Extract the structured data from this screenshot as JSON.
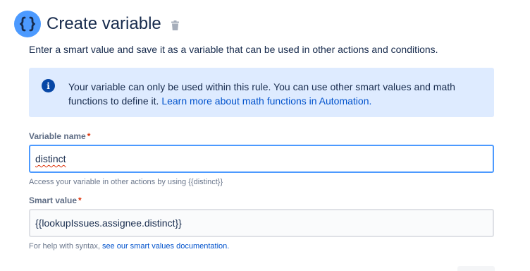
{
  "header": {
    "title": "Create variable",
    "icon": "curly-braces-icon",
    "delete_icon": "trash-icon"
  },
  "description": "Enter a smart value and save it as a variable that can be used in other actions and conditions.",
  "info": {
    "icon": "info-icon",
    "glyph": "i",
    "text": "Your variable can only be used within this rule. You can use other smart values and math functions to define it.",
    "link": "Learn more about math functions in Automation."
  },
  "fields": {
    "variable_name": {
      "label": "Variable name",
      "required": "*",
      "value": "distinct",
      "helper": "Access your variable in other actions by using {{distinct}}"
    },
    "smart_value": {
      "label": "Smart value",
      "required": "*",
      "value": "{{lookupIssues.assignee.distinct}}",
      "helper": "For help with syntax,",
      "helper_link": "see our smart values documentation."
    }
  },
  "colors": {
    "accent": "#4c9aff",
    "info_bg": "#deebff",
    "link": "#0052cc",
    "required": "#de350b"
  }
}
